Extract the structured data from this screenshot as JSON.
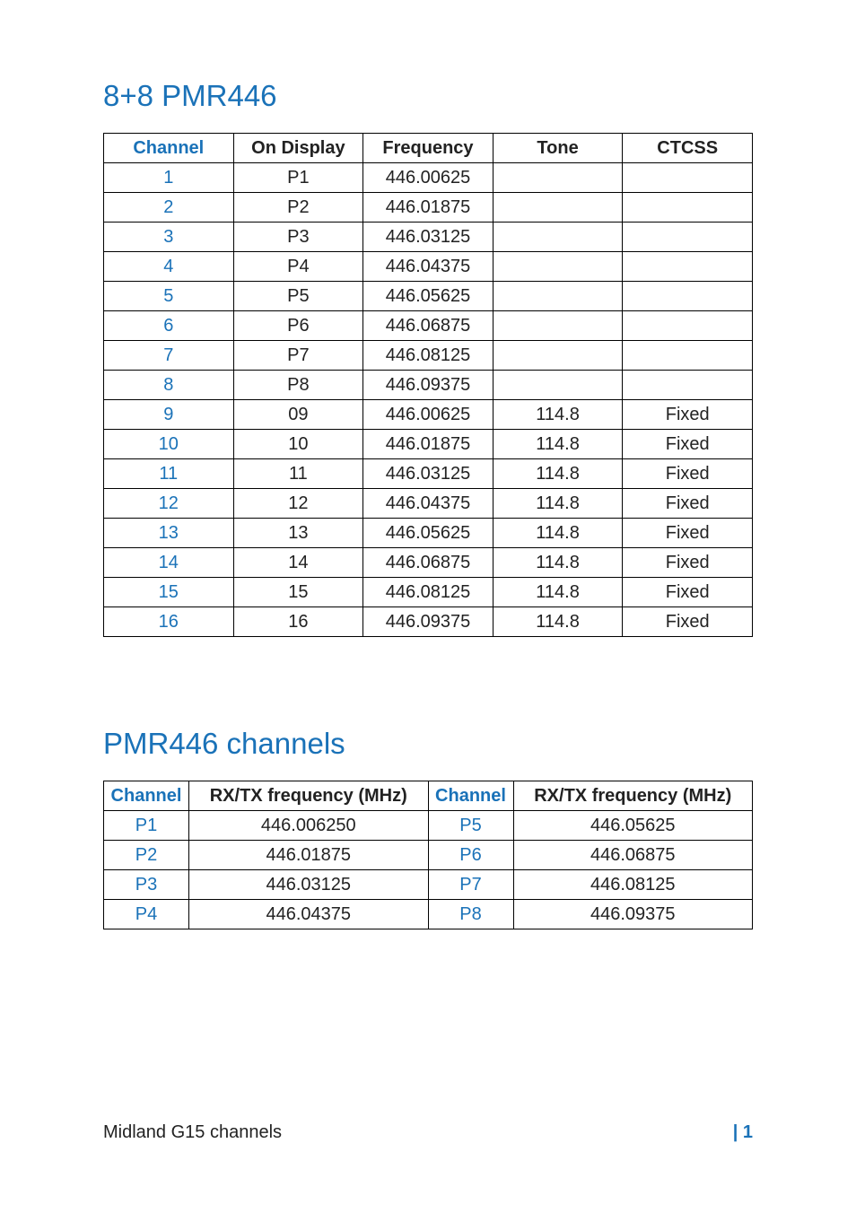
{
  "section1": {
    "title": "8+8 PMR446",
    "headers": [
      "Channel",
      "On Display",
      "Frequency",
      "Tone",
      "CTCSS"
    ],
    "rows": [
      {
        "c": "1",
        "d": "P1",
        "f": "446.00625",
        "t": "",
        "s": ""
      },
      {
        "c": "2",
        "d": "P2",
        "f": "446.01875",
        "t": "",
        "s": ""
      },
      {
        "c": "3",
        "d": "P3",
        "f": "446.03125",
        "t": "",
        "s": ""
      },
      {
        "c": "4",
        "d": "P4",
        "f": "446.04375",
        "t": "",
        "s": ""
      },
      {
        "c": "5",
        "d": "P5",
        "f": "446.05625",
        "t": "",
        "s": ""
      },
      {
        "c": "6",
        "d": "P6",
        "f": "446.06875",
        "t": "",
        "s": ""
      },
      {
        "c": "7",
        "d": "P7",
        "f": "446.08125",
        "t": "",
        "s": ""
      },
      {
        "c": "8",
        "d": "P8",
        "f": "446.09375",
        "t": "",
        "s": ""
      },
      {
        "c": "9",
        "d": "09",
        "f": "446.00625",
        "t": "114.8",
        "s": "Fixed"
      },
      {
        "c": "10",
        "d": "10",
        "f": "446.01875",
        "t": "114.8",
        "s": "Fixed"
      },
      {
        "c": "11",
        "d": "11",
        "f": "446.03125",
        "t": "114.8",
        "s": "Fixed"
      },
      {
        "c": "12",
        "d": "12",
        "f": "446.04375",
        "t": "114.8",
        "s": "Fixed"
      },
      {
        "c": "13",
        "d": "13",
        "f": "446.05625",
        "t": "114.8",
        "s": "Fixed"
      },
      {
        "c": "14",
        "d": "14",
        "f": "446.06875",
        "t": "114.8",
        "s": "Fixed"
      },
      {
        "c": "15",
        "d": "15",
        "f": "446.08125",
        "t": "114.8",
        "s": "Fixed"
      },
      {
        "c": "16",
        "d": "16",
        "f": "446.09375",
        "t": "114.8",
        "s": "Fixed"
      }
    ]
  },
  "section2": {
    "title": "PMR446 channels",
    "headers": [
      "Channel",
      "RX/TX frequency (MHz)",
      "Channel",
      "RX/TX frequency (MHz)"
    ],
    "rows": [
      {
        "c1": "P1",
        "f1": "446.006250",
        "c2": "P5",
        "f2": "446.05625"
      },
      {
        "c1": "P2",
        "f1": "446.01875",
        "c2": "P6",
        "f2": "446.06875"
      },
      {
        "c1": "P3",
        "f1": "446.03125",
        "c2": "P7",
        "f2": "446.08125"
      },
      {
        "c1": "P4",
        "f1": "446.04375",
        "c2": "P8",
        "f2": "446.09375"
      }
    ]
  },
  "footer": {
    "left": "Midland G15 channels",
    "sep": "| ",
    "page": "1"
  }
}
